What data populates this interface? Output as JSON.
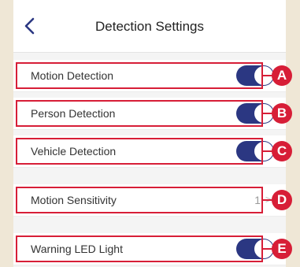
{
  "header": {
    "title": "Detection Settings",
    "back_icon": "chevron-left-icon"
  },
  "settings": [
    {
      "label": "Motion Detection",
      "type": "toggle",
      "on": true,
      "badge": "A"
    },
    {
      "label": "Person Detection",
      "type": "toggle",
      "on": true,
      "badge": "B"
    },
    {
      "label": "Vehicle Detection",
      "type": "toggle",
      "on": true,
      "badge": "C"
    },
    {
      "label": "Motion Sensitivity",
      "type": "value",
      "value": "1",
      "chevron": ">",
      "badge": "D"
    },
    {
      "label": "Warning LED Light",
      "type": "toggle",
      "on": true,
      "badge": "E"
    }
  ],
  "colors": {
    "toggle_on": "#2b3782",
    "annotation": "#d71e37",
    "background": "#efe7d6"
  }
}
